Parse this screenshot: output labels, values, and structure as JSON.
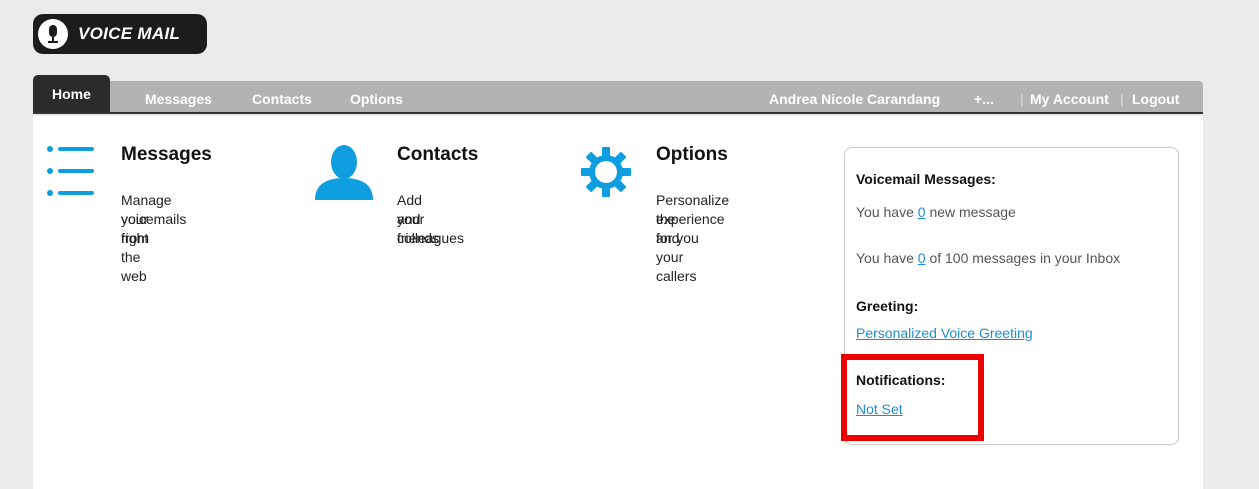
{
  "logo": {
    "text": "VOICE MAIL",
    "icon": "microphone-icon"
  },
  "nav": {
    "home": "Home",
    "messages": "Messages",
    "contacts": "Contacts",
    "options": "Options",
    "user_name": "Andrea Nicole Carandang",
    "user_extra": "+...",
    "separator": "|",
    "my_account": "My Account",
    "logout": "Logout"
  },
  "features": {
    "messages": {
      "title": "Messages",
      "desc": "Manage your voicemails right from the web",
      "line1": "Manage your",
      "line2": "voicemails right",
      "line3": "from the web",
      "icon": "list-icon"
    },
    "contacts": {
      "title": "Contacts",
      "line1": "Add your friends",
      "line2": "and colleagues",
      "icon": "person-icon"
    },
    "options": {
      "title": "Options",
      "line1": "Personalize the",
      "line2": "experience for you",
      "line3": "and your callers",
      "icon": "gear-icon"
    }
  },
  "summary": {
    "voicemail_title": "Voicemail Messages:",
    "new_prefix": "You have ",
    "new_count": "0",
    "new_suffix": " new message",
    "inbox_prefix": "You have ",
    "inbox_count": "0",
    "inbox_suffix": " of 100 messages in your Inbox",
    "greeting_title": "Greeting:",
    "greeting_link": "Personalized Voice Greeting",
    "notifications_title": "Notifications:",
    "notifications_link": "Not Set"
  },
  "colors": {
    "accent": "#0e9ee0",
    "link": "#1f8ecf",
    "nav_bg": "#b3b3b3",
    "nav_active": "#2b2b2b",
    "highlight": "#ee0000"
  }
}
